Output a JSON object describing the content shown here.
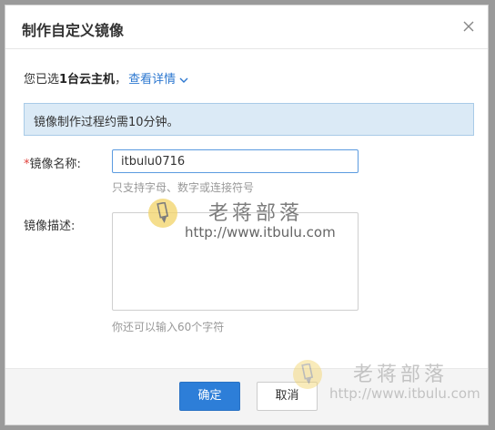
{
  "dialog": {
    "title": "制作自定义镜像",
    "close_icon": "close-icon"
  },
  "selection": {
    "prefix": "您已选",
    "count_text": "1台云主机",
    "separator": "，",
    "details_link": "查看详情"
  },
  "info_banner": {
    "text": "镜像制作过程约需10分钟。"
  },
  "name_field": {
    "required_mark": "*",
    "label": "镜像名称:",
    "value": "itbulu0716",
    "hint": "只支持字母、数字或连接符号"
  },
  "description_field": {
    "label": "镜像描述:",
    "value": "",
    "hint": "你还可以输入60个字符"
  },
  "footer": {
    "confirm_label": "确定",
    "cancel_label": "取消"
  },
  "watermarks": [
    {
      "name": "老蒋部落",
      "url": "http://www.itbulu.com"
    },
    {
      "name": "老蒋部落",
      "url": "http://www.itbulu.com"
    }
  ],
  "colors": {
    "accent": "#2d7ed8",
    "link": "#2d78d0",
    "banner_bg": "#dbeaf6",
    "banner_border": "#a9cbe7",
    "required": "#e0403a"
  }
}
